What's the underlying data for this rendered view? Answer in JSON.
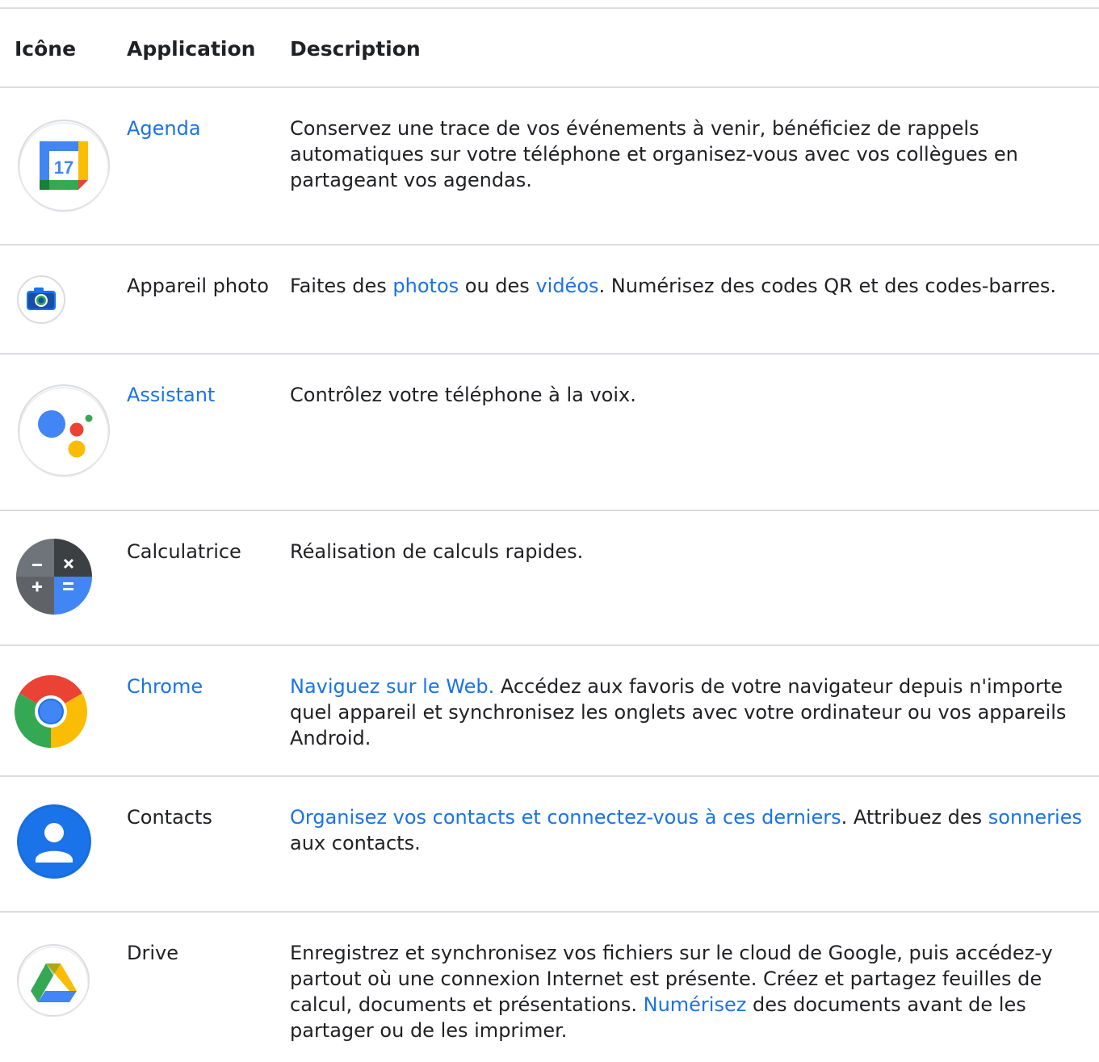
{
  "table": {
    "headers": {
      "icon": "Icône",
      "app": "Application",
      "desc": "Description"
    },
    "rows": [
      {
        "app": "Agenda",
        "app_is_link": true,
        "icon": "calendar-icon",
        "desc": {
          "t1": "Conservez une trace de vos événements à venir, bénéficiez de rappels automatiques sur votre téléphone et organisez-vous avec vos collègues en partageant vos agendas."
        },
        "icon_text": "17"
      },
      {
        "app": "Appareil photo",
        "app_is_link": false,
        "icon": "camera-icon",
        "desc": {
          "t1": "Faites des ",
          "l1": "photos",
          "t2": " ou des ",
          "l2": "vidéos",
          "t3": ". Numérisez des codes QR et des codes-barres."
        }
      },
      {
        "app": "Assistant",
        "app_is_link": true,
        "icon": "assistant-icon",
        "desc": {
          "t1": "Contrôlez votre téléphone à la voix."
        }
      },
      {
        "app": "Calculatrice",
        "app_is_link": false,
        "icon": "calculator-icon",
        "desc": {
          "t1": "Réalisation de calculs rapides."
        }
      },
      {
        "app": "Chrome",
        "app_is_link": true,
        "icon": "chrome-icon",
        "desc": {
          "l1": "Naviguez sur le Web.",
          "t1": " Accédez aux favoris de votre navigateur depuis n'importe quel appareil et synchronisez les onglets avec votre ordinateur ou vos appareils Android."
        }
      },
      {
        "app": "Contacts",
        "app_is_link": false,
        "icon": "contacts-icon",
        "desc": {
          "l1": "Organisez vos contacts et connectez-vous à ces derniers",
          "t1": ". Attribuez des ",
          "l2": "sonneries",
          "t2": " aux contacts."
        }
      },
      {
        "app": "Drive",
        "app_is_link": false,
        "icon": "drive-icon",
        "desc": {
          "t1": "Enregistrez et synchronisez vos fichiers sur le cloud de Google, puis accédez-y partout où une connexion Internet est présente. Créez et partagez feuilles de calcul, documents et présentations. ",
          "l1": "Numérisez",
          "t2": " des documents avant de les partager ou de les imprimer."
        }
      }
    ]
  },
  "colors": {
    "link": "#1a73e8",
    "text": "#202124",
    "rule": "#dadce0",
    "google_blue": "#4285f4",
    "google_red": "#ea4335",
    "google_yellow": "#fbbc04",
    "google_green": "#34a853"
  }
}
